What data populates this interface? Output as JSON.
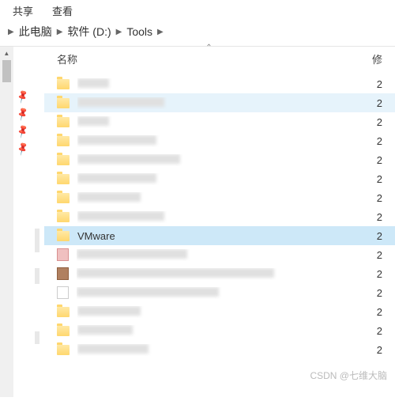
{
  "tabs": {
    "share": "共享",
    "view": "查看"
  },
  "breadcrumb": {
    "items": [
      "此电脑",
      "软件 (D:)",
      "Tools"
    ]
  },
  "headers": {
    "name": "名称",
    "modified": "修"
  },
  "rows": [
    {
      "type": "folder",
      "date": "2"
    },
    {
      "type": "folder",
      "state": "hovered",
      "date": "2"
    },
    {
      "type": "folder",
      "date": "2"
    },
    {
      "type": "folder",
      "date": "2"
    },
    {
      "type": "folder",
      "date": "2"
    },
    {
      "type": "folder",
      "date": "2"
    },
    {
      "type": "folder",
      "date": "2"
    },
    {
      "type": "folder",
      "date": "2"
    },
    {
      "type": "folder",
      "label": "VMware",
      "state": "selected",
      "date": "2"
    },
    {
      "type": "file-pink",
      "date": "2"
    },
    {
      "type": "file-brown",
      "date": "2"
    },
    {
      "type": "file",
      "date": "2"
    },
    {
      "type": "folder",
      "date": "2"
    },
    {
      "type": "folder",
      "date": "2"
    },
    {
      "type": "folder",
      "date": "2"
    }
  ],
  "watermark": "CSDN @七维大脑"
}
